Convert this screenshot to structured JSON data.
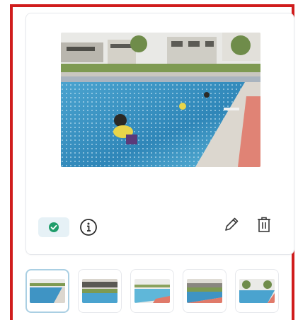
{
  "gallery": {
    "main_image": {
      "description_icon": "pool-photo",
      "verified": true
    },
    "actions": {
      "approve_icon": "check-circle-icon",
      "info_icon": "info-icon",
      "edit_icon": "pencil-icon",
      "delete_icon": "trash-icon"
    },
    "thumbnails": [
      {
        "selected": true
      },
      {
        "selected": false
      },
      {
        "selected": false
      },
      {
        "selected": false
      },
      {
        "selected": false
      }
    ]
  },
  "colors": {
    "frame_border": "#d01d1d",
    "check_green": "#1f9d6b",
    "pill_bg": "#e6f1f6",
    "active_thumb_border": "#aacfe3"
  }
}
